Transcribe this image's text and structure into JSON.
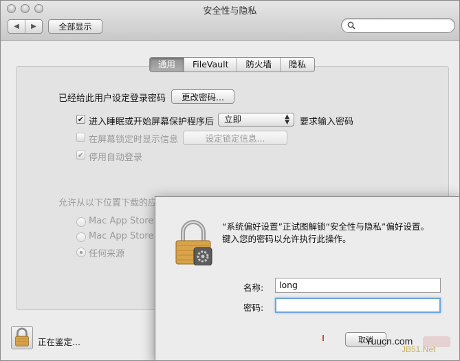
{
  "window": {
    "title": "安全性与隐私"
  },
  "toolbar": {
    "back_glyph": "◀",
    "forward_glyph": "▶",
    "show_all_label": "全部显示",
    "search_placeholder": ""
  },
  "tabs": [
    {
      "label": "通用",
      "active": true
    },
    {
      "label": "FileVault",
      "active": false
    },
    {
      "label": "防火墙",
      "active": false
    },
    {
      "label": "隐私",
      "active": false
    }
  ],
  "general": {
    "password_set_text": "已经给此用户设定登录密码",
    "change_password_button": "更改密码...",
    "require_password": {
      "checked": true,
      "label": "进入睡眠或开始屏幕保护程序后",
      "delay_value": "立即",
      "suffix": "要求输入密码"
    },
    "show_message": {
      "checked": false,
      "label": "在屏幕锁定时显示信息",
      "button": "设定锁定信息..."
    },
    "disable_autologin": {
      "checked": true,
      "label": "停用自动登录"
    },
    "allow_apps_label": "允许从以下位置下载的应",
    "allow_options": [
      {
        "label": "Mac App Store",
        "selected": false
      },
      {
        "label": "Mac App Store",
        "selected": false
      },
      {
        "label": "任何来源",
        "selected": true
      }
    ]
  },
  "bottom": {
    "status": "正在鉴定..."
  },
  "auth_dialog": {
    "message_line1": "“系统偏好设置”正试图解锁“安全性与隐私”偏好设置。",
    "message_line2": "键入您的密码以允许执行此操作。",
    "name_label": "名称:",
    "name_value": "long",
    "password_label": "密码:",
    "password_value": "",
    "button_label": "取消"
  },
  "watermark": {
    "text1": "Yuucn.com",
    "text2": "JB51.Net"
  },
  "check_glyph": "✔"
}
